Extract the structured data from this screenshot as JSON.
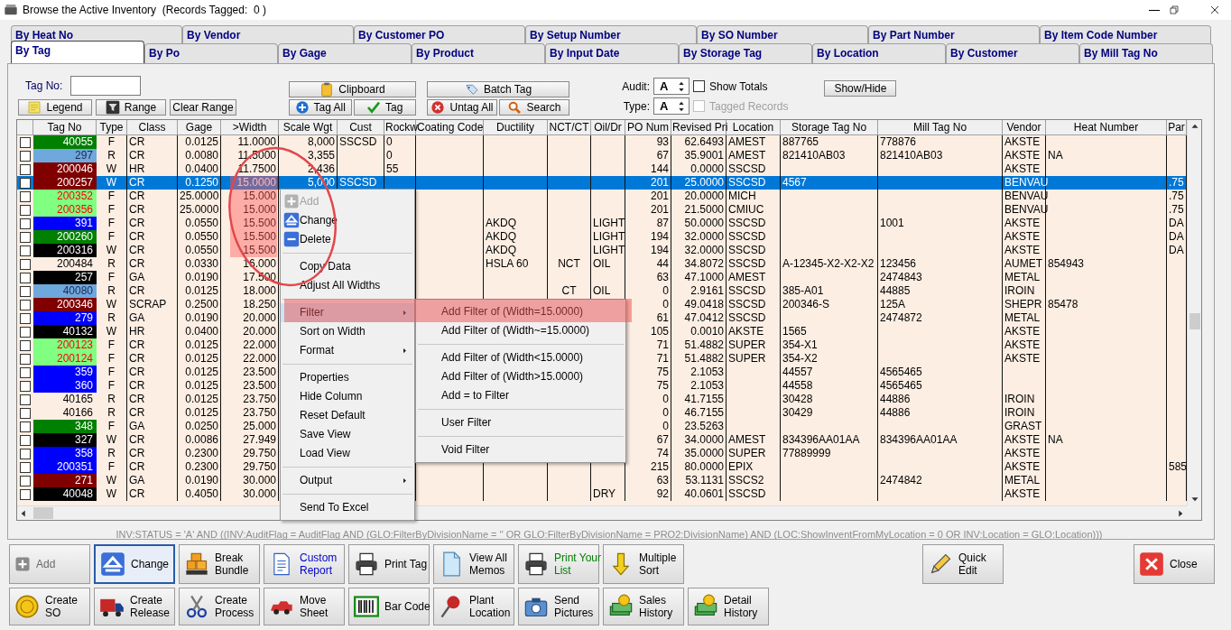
{
  "window": {
    "title": "Browse the Active Inventory  (Records Tagged:  0 )"
  },
  "tab_rows": [
    {
      "tabs": [
        {
          "label": "By Heat No",
          "selected": false
        },
        {
          "label": "By Vendor",
          "selected": false
        },
        {
          "label": "By Customer PO",
          "selected": false
        },
        {
          "label": "By Setup Number",
          "selected": false
        },
        {
          "label": "By SO Number",
          "selected": false
        },
        {
          "label": "By Part Number",
          "selected": false
        },
        {
          "label": "By Item Code Number",
          "selected": false
        }
      ]
    },
    {
      "tabs": [
        {
          "label": "By Tag",
          "selected": true
        },
        {
          "label": "By Po",
          "selected": false
        },
        {
          "label": "By Gage",
          "selected": false
        },
        {
          "label": "By Product",
          "selected": false
        },
        {
          "label": "By Input Date",
          "selected": false
        },
        {
          "label": "By Storage Tag",
          "selected": false
        },
        {
          "label": "By Location",
          "selected": false
        },
        {
          "label": "By Customer",
          "selected": false
        },
        {
          "label": "By Mill Tag No",
          "selected": false
        }
      ]
    }
  ],
  "toolbar": {
    "tag_no": {
      "label": "Tag No:"
    },
    "range_buttons": [
      "Legend",
      "Range",
      "Clear Range"
    ],
    "clipboard_buttons": {
      "top": "Clipboard",
      "bottom": [
        "Tag All",
        "Tag"
      ]
    },
    "batch_buttons": {
      "top": "Batch Tag",
      "bottom": [
        "Untag All",
        "Search"
      ]
    },
    "spinners": [
      {
        "label": "Audit:",
        "value": "A"
      },
      {
        "label": "Type:",
        "value": "A"
      }
    ],
    "checkboxes": [
      {
        "label": "Show Totals",
        "checked": false,
        "disabled": false
      },
      {
        "label": "Tagged Records",
        "checked": false,
        "disabled": true
      }
    ],
    "show_hide": "Show/Hide"
  },
  "grid": {
    "columns": [
      "Tag No",
      "Type",
      "Class",
      "Gage",
      ">Width",
      "Scale Wgt",
      "Cust",
      "Rockw",
      "Coating Code",
      "Ductility",
      "NCT/CT",
      "Oil/Dr",
      "PO Num",
      "Revised Pri",
      "Location",
      "Storage Tag No",
      "Mill Tag No",
      "Vendor",
      "Heat Number",
      "Par"
    ],
    "rows": [
      {
        "checked": false,
        "selected": false,
        "color": "#008000",
        "alert": false,
        "cells": [
          "40055",
          "F",
          "CR",
          "0.0125",
          "11.0000",
          "8,000",
          "SSCSD",
          "0",
          null,
          null,
          null,
          null,
          "93",
          "62.6493",
          "AMEST",
          "887765",
          "778876",
          "AKSTE",
          null,
          null
        ]
      },
      {
        "checked": false,
        "selected": false,
        "color": "#6fa8dc",
        "alert": false,
        "cells": [
          "297",
          "R",
          "CR",
          "0.0080",
          "11.5000",
          "3,355",
          null,
          "0",
          null,
          null,
          null,
          null,
          "67",
          "35.9001",
          "AMEST",
          "821410AB03",
          "821410AB03",
          "AKSTE",
          "NA",
          null
        ]
      },
      {
        "checked": false,
        "selected": false,
        "color": "#800000",
        "alert": false,
        "cells": [
          "200046",
          "W",
          "HR",
          "0.0400",
          "11.7500",
          "2,436",
          null,
          "55",
          null,
          null,
          null,
          null,
          "144",
          "0.0000",
          "SSCSD",
          null,
          null,
          "AKSTE",
          null,
          null
        ]
      },
      {
        "checked": false,
        "selected": true,
        "color": "#800000",
        "alert": false,
        "cells": [
          "200257",
          "W",
          "CR",
          "0.1250",
          "15.0000",
          "5,000",
          "SSCSD",
          null,
          null,
          null,
          null,
          null,
          "201",
          "25.0000",
          "SSCSD",
          "4567",
          null,
          "BENVAU",
          null,
          ".75"
        ]
      },
      {
        "checked": false,
        "selected": false,
        "color": "#80ff80",
        "alert": true,
        "cells": [
          "200352",
          "F",
          "CR",
          "25.0000",
          "15.000",
          null,
          null,
          null,
          null,
          null,
          null,
          null,
          "201",
          "20.0000",
          "MICH",
          null,
          null,
          "BENVAU",
          null,
          ".75"
        ]
      },
      {
        "checked": false,
        "selected": false,
        "color": "#80ff80",
        "alert": true,
        "cells": [
          "200356",
          "F",
          "CR",
          "25.0000",
          "15.000",
          null,
          null,
          null,
          null,
          null,
          null,
          null,
          "201",
          "21.5000",
          "CMIUC",
          null,
          null,
          "BENVAU",
          null,
          ".75"
        ]
      },
      {
        "checked": false,
        "selected": false,
        "color": "#0000ff",
        "alert": false,
        "cells": [
          "391",
          "F",
          "CR",
          "0.0550",
          "15.500",
          null,
          null,
          null,
          null,
          "AKDQ",
          null,
          "LIGHT",
          "87",
          "50.0000",
          "SSCSD",
          null,
          "1001",
          "AKSTE",
          null,
          "DA"
        ]
      },
      {
        "checked": false,
        "selected": false,
        "color": "#008000",
        "alert": false,
        "cells": [
          "200260",
          "F",
          "CR",
          "0.0550",
          "15.500",
          null,
          null,
          null,
          null,
          "AKDQ",
          null,
          "LIGHT",
          "194",
          "32.0000",
          "SSCSD",
          null,
          null,
          "AKSTE",
          null,
          "DA"
        ]
      },
      {
        "checked": false,
        "selected": false,
        "color": "#000000",
        "alert": false,
        "cells": [
          "200316",
          "W",
          "CR",
          "0.0550",
          "15.500",
          null,
          null,
          null,
          null,
          "AKDQ",
          null,
          "LIGHT",
          "194",
          "32.0000",
          "SSCSD",
          null,
          null,
          "AKSTE",
          null,
          "DA"
        ]
      },
      {
        "checked": false,
        "selected": false,
        "alert": false,
        "cells": [
          "200484",
          "R",
          "CR",
          "0.0330",
          "16.000",
          null,
          null,
          null,
          null,
          "HSLA 60",
          "NCT",
          "OIL",
          "44",
          "34.8072",
          "SSCSD",
          "A-12345-X2-X2-X2",
          "123456",
          "AUMET",
          "854943",
          null
        ]
      },
      {
        "checked": false,
        "selected": false,
        "color": "#000000",
        "alert": false,
        "cells": [
          "257",
          "F",
          "GA",
          "0.0190",
          "17.500",
          null,
          null,
          null,
          null,
          null,
          null,
          null,
          "63",
          "47.1000",
          "AMEST",
          null,
          "2474843",
          "METAL",
          null,
          null
        ]
      },
      {
        "checked": false,
        "selected": false,
        "color": "#6fa8dc",
        "alert": false,
        "cells": [
          "40080",
          "R",
          "CR",
          "0.0125",
          "18.000",
          null,
          null,
          null,
          null,
          null,
          "CT",
          "OIL",
          "0",
          "2.9161",
          "SSCSD",
          "385-A01",
          "44885",
          "IROIN",
          null,
          null
        ]
      },
      {
        "checked": false,
        "selected": false,
        "color": "#800000",
        "alert": false,
        "cells": [
          "200346",
          "W",
          "SCRAP",
          "0.2500",
          "18.250",
          null,
          null,
          null,
          null,
          null,
          null,
          null,
          "0",
          "49.0418",
          "SSCSD",
          "200346-S",
          "125A",
          "SHEPR",
          "85478",
          null
        ]
      },
      {
        "checked": false,
        "selected": false,
        "color": "#0000ff",
        "alert": false,
        "cells": [
          "279",
          "R",
          "GA",
          "0.0190",
          "20.000",
          null,
          null,
          null,
          null,
          null,
          null,
          null,
          "61",
          "47.0412",
          "SSCSD",
          null,
          "2474872",
          "METAL",
          null,
          null
        ]
      },
      {
        "checked": false,
        "selected": false,
        "color": "#000000",
        "alert": false,
        "cells": [
          "40132",
          "W",
          "HR",
          "0.0400",
          "20.000",
          null,
          null,
          null,
          null,
          null,
          null,
          null,
          "105",
          "0.0010",
          "AKSTE",
          "1565",
          null,
          "AKSTE",
          null,
          null
        ]
      },
      {
        "checked": false,
        "selected": false,
        "color": "#80ff80",
        "alert": true,
        "cells": [
          "200123",
          "F",
          "CR",
          "0.0125",
          "22.000",
          null,
          null,
          null,
          null,
          null,
          null,
          null,
          "71",
          "51.4882",
          "SUPER",
          "354-X1",
          null,
          "AKSTE",
          null,
          null
        ]
      },
      {
        "checked": false,
        "selected": false,
        "color": "#80ff80",
        "alert": true,
        "cells": [
          "200124",
          "F",
          "CR",
          "0.0125",
          "22.000",
          null,
          null,
          null,
          null,
          null,
          null,
          null,
          "71",
          "51.4882",
          "SUPER",
          "354-X2",
          null,
          "AKSTE",
          null,
          null
        ]
      },
      {
        "checked": false,
        "selected": false,
        "color": "#0000ff",
        "alert": false,
        "cells": [
          "359",
          "F",
          "CR",
          "0.0125",
          "23.500",
          null,
          null,
          null,
          null,
          null,
          null,
          null,
          "75",
          "2.1053",
          null,
          "44557",
          "4565465",
          null,
          null,
          null
        ]
      },
      {
        "checked": false,
        "selected": false,
        "color": "#0000ff",
        "alert": false,
        "cells": [
          "360",
          "F",
          "CR",
          "0.0125",
          "23.500",
          null,
          null,
          null,
          null,
          null,
          null,
          null,
          "75",
          "2.1053",
          null,
          "44558",
          "4565465",
          null,
          null,
          null
        ]
      },
      {
        "checked": false,
        "selected": false,
        "alert": false,
        "cells": [
          "40165",
          "R",
          "CR",
          "0.0125",
          "23.750",
          null,
          null,
          null,
          null,
          null,
          null,
          null,
          "0",
          "41.7155",
          null,
          "30428",
          "44886",
          "IROIN",
          null,
          null
        ]
      },
      {
        "checked": false,
        "selected": false,
        "alert": false,
        "cells": [
          "40166",
          "R",
          "CR",
          "0.0125",
          "23.750",
          null,
          null,
          null,
          null,
          null,
          null,
          null,
          "0",
          "46.7155",
          null,
          "30429",
          "44886",
          "IROIN",
          null,
          null
        ]
      },
      {
        "checked": false,
        "selected": false,
        "color": "#008000",
        "alert": false,
        "cells": [
          "348",
          "F",
          "GA",
          "0.0250",
          "25.000",
          null,
          null,
          null,
          null,
          null,
          null,
          null,
          "0",
          "23.5263",
          null,
          null,
          null,
          "GRAST",
          null,
          null
        ]
      },
      {
        "checked": false,
        "selected": false,
        "color": "#000000",
        "alert": false,
        "cells": [
          "327",
          "W",
          "CR",
          "0.0086",
          "27.949",
          null,
          null,
          null,
          null,
          null,
          null,
          null,
          "67",
          "34.0000",
          "AMEST",
          "834396AA01AA",
          "834396AA01AA",
          "AKSTE",
          "NA",
          null
        ]
      },
      {
        "checked": false,
        "selected": false,
        "color": "#0000ff",
        "alert": false,
        "cells": [
          "358",
          "R",
          "CR",
          "0.2300",
          "29.750",
          null,
          null,
          null,
          null,
          null,
          null,
          null,
          "74",
          "35.0000",
          "SUPER",
          "77889999",
          null,
          "AKSTE",
          null,
          null
        ]
      },
      {
        "checked": false,
        "selected": false,
        "color": "#0000ff",
        "alert": false,
        "cells": [
          "200351",
          "F",
          "CR",
          "0.2300",
          "29.750",
          null,
          null,
          null,
          null,
          null,
          null,
          null,
          "215",
          "80.0000",
          "EPIX",
          null,
          null,
          "AKSTE",
          null,
          "585"
        ]
      },
      {
        "checked": false,
        "selected": false,
        "color": "#800000",
        "alert": false,
        "cells": [
          "271",
          "W",
          "GA",
          "0.0190",
          "30.000",
          null,
          null,
          null,
          null,
          null,
          null,
          null,
          "63",
          "53.1131",
          "SSCS2",
          null,
          "2474842",
          "METAL",
          null,
          null
        ]
      },
      {
        "checked": false,
        "selected": false,
        "color": "#000000",
        "alert": false,
        "cells": [
          "40048",
          "W",
          "CR",
          "0.4050",
          "30.000",
          null,
          null,
          null,
          null,
          null,
          null,
          "DRY",
          "92",
          "40.0601",
          "SSCSD",
          null,
          null,
          "AKSTE",
          null,
          null
        ]
      }
    ],
    "filter_expression": "INV:STATUS = 'A' AND ((INV:AuditFlag = AuditFlag AND (GLO:FilterByDivisionName = '' OR GLO:FilterByDivisionName = PRO2:DivisionName) AND (LOC:ShowInventFromMyLocation = 0 OR INV:Location = GLO:Location)))"
  },
  "context_menu": {
    "items": [
      {
        "kind": "command",
        "label": "Add",
        "disabled": true
      },
      {
        "kind": "command",
        "label": "Change",
        "disabled": false
      },
      {
        "kind": "command",
        "label": "Delete",
        "disabled": false
      },
      {
        "kind": "separator"
      },
      {
        "kind": "command",
        "label": "Copy Data",
        "disabled": false
      },
      {
        "kind": "command",
        "label": "Adjust All Widths",
        "disabled": false
      },
      {
        "kind": "separator"
      },
      {
        "kind": "submenu",
        "label": "Filter",
        "disabled": false,
        "expanded": true,
        "items": [
          {
            "kind": "command",
            "label": "Add Filter of (Width=15.0000)",
            "disabled": false
          },
          {
            "kind": "command",
            "label": "Add Filter of (Width~=15.0000)",
            "disabled": false
          },
          {
            "kind": "separator"
          },
          {
            "kind": "command",
            "label": "Add Filter of (Width<15.0000)",
            "disabled": false
          },
          {
            "kind": "command",
            "label": "Add Filter of (Width>15.0000)",
            "disabled": false
          },
          {
            "kind": "command",
            "label": "Add = to Filter",
            "disabled": false
          },
          {
            "kind": "separator"
          },
          {
            "kind": "command",
            "label": "User Filter",
            "disabled": false
          },
          {
            "kind": "separator"
          },
          {
            "kind": "command",
            "label": "Void Filter",
            "disabled": false
          }
        ]
      },
      {
        "kind": "command",
        "label": "Sort on Width",
        "disabled": false
      },
      {
        "kind": "submenu",
        "label": "Format",
        "disabled": false,
        "expanded": false
      },
      {
        "kind": "separator"
      },
      {
        "kind": "command",
        "label": "Properties",
        "disabled": false
      },
      {
        "kind": "command",
        "label": "Hide Column",
        "disabled": false
      },
      {
        "kind": "command",
        "label": "Reset Default",
        "disabled": false
      },
      {
        "kind": "command",
        "label": "Save View",
        "disabled": false
      },
      {
        "kind": "command",
        "label": "Load View",
        "disabled": false
      },
      {
        "kind": "separator"
      },
      {
        "kind": "submenu",
        "label": "Output",
        "disabled": false,
        "expanded": false
      },
      {
        "kind": "separator"
      },
      {
        "kind": "command",
        "label": "Send To Excel",
        "disabled": false
      }
    ]
  },
  "bottom_bar": {
    "row_1": [
      {
        "label_lines": [
          "Add"
        ],
        "disabled": true,
        "focused": false
      },
      {
        "label_lines": [
          "Change"
        ],
        "disabled": false,
        "focused": true
      },
      {
        "label_lines": [
          "Break",
          "Bundle"
        ],
        "disabled": false,
        "focused": false
      },
      {
        "label_lines": [
          "Custom",
          "Report"
        ],
        "disabled": false,
        "focused": false,
        "color": "#0000cc"
      },
      {
        "label_lines": [
          "Print Tag"
        ],
        "disabled": false,
        "focused": false
      },
      {
        "label_lines": [
          "View All",
          "Memos"
        ],
        "disabled": false,
        "focused": false
      },
      {
        "label_lines": [
          "Print Your",
          "List"
        ],
        "disabled": false,
        "focused": false,
        "color": "#008000"
      },
      {
        "label_lines": [
          "Multiple",
          "Sort"
        ],
        "disabled": false,
        "focused": false
      }
    ],
    "row_1_right": [
      {
        "label_lines": [
          "Quick",
          "Edit"
        ],
        "disabled": false,
        "focused": false
      },
      {
        "label_lines": [
          "Close"
        ],
        "disabled": false,
        "focused": false
      }
    ],
    "row_2": [
      {
        "label_lines": [
          "Create",
          "SO"
        ],
        "disabled": false,
        "focused": false
      },
      {
        "label_lines": [
          "Create",
          "Release"
        ],
        "disabled": false,
        "focused": false
      },
      {
        "label_lines": [
          "Create",
          "Process"
        ],
        "disabled": false,
        "focused": false
      },
      {
        "label_lines": [
          "Move",
          "Sheet"
        ],
        "disabled": false,
        "focused": false
      },
      {
        "label_lines": [
          "Bar Code"
        ],
        "disabled": false,
        "focused": false
      },
      {
        "label_lines": [
          "Plant",
          "Location"
        ],
        "disabled": false,
        "focused": false
      },
      {
        "label_lines": [
          "Send",
          "Pictures"
        ],
        "disabled": false,
        "focused": false
      },
      {
        "label_lines": [
          "Sales",
          "History"
        ],
        "disabled": false,
        "focused": false
      },
      {
        "label_lines": [
          "Detail",
          "History"
        ],
        "disabled": false,
        "focused": false
      }
    ]
  }
}
